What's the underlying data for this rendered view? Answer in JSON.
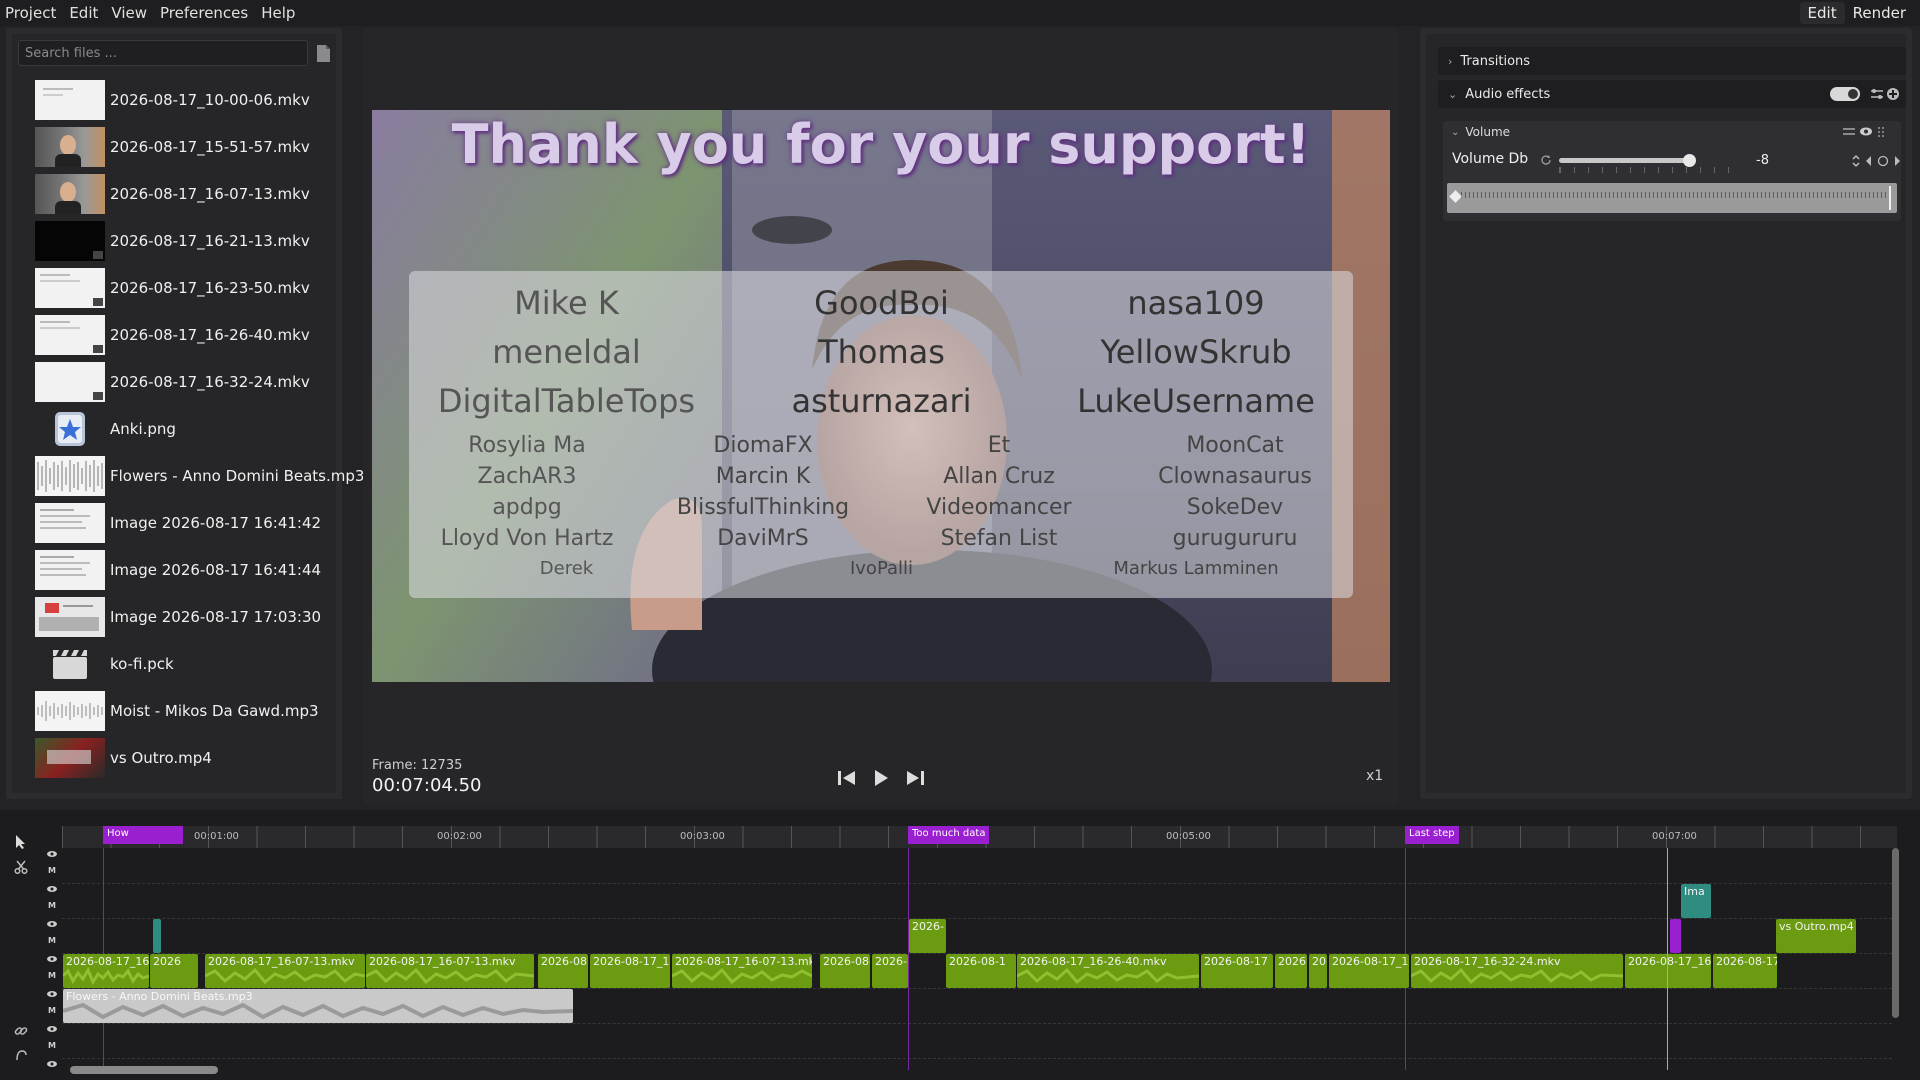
{
  "menu": {
    "items": [
      "Project",
      "Edit",
      "View",
      "Preferences",
      "Help"
    ],
    "right": [
      "Edit",
      "Render"
    ]
  },
  "files": {
    "search_placeholder": "Search files ...",
    "items": [
      {
        "name": "2026-08-17_10-00-06.mkv",
        "thumb": "doc-icon"
      },
      {
        "name": "2026-08-17_15-51-57.mkv",
        "thumb": "person-icon"
      },
      {
        "name": "2026-08-17_16-07-13.mkv",
        "thumb": "person-icon"
      },
      {
        "name": "2026-08-17_16-21-13.mkv",
        "thumb": "black-icon"
      },
      {
        "name": "2026-08-17_16-23-50.mkv",
        "thumb": "doc-icon"
      },
      {
        "name": "2026-08-17_16-26-40.mkv",
        "thumb": "doc-icon"
      },
      {
        "name": "2026-08-17_16-32-24.mkv",
        "thumb": "doc-icon"
      },
      {
        "name": "Anki.png",
        "thumb": "star-icon"
      },
      {
        "name": "Flowers - Anno Domini Beats.mp3",
        "thumb": "waveform-icon"
      },
      {
        "name": "Image 2026-08-17 16:41:42",
        "thumb": "doc-icon"
      },
      {
        "name": "Image 2026-08-17 16:41:44",
        "thumb": "doc-icon"
      },
      {
        "name": "Image 2026-08-17 17:03:30",
        "thumb": "mixed-icon"
      },
      {
        "name": "ko-fi.pck",
        "thumb": "clapper-icon"
      },
      {
        "name": "Moist - Mikos Da Gawd.mp3",
        "thumb": "waveform-icon"
      },
      {
        "name": "vs Outro.mp4",
        "thumb": "outro-icon"
      }
    ]
  },
  "preview": {
    "title": "Thank you for your support!",
    "supporters_big": [
      [
        "Mike K",
        "GoodBoi",
        "nasa109"
      ],
      [
        "meneldal",
        "Thomas",
        "YellowSkrub"
      ],
      [
        "DigitalTableTops",
        "asturnazari",
        "LukeUsername"
      ]
    ],
    "supporters_small": [
      [
        "Rosylia Ma",
        "DiomaFX",
        "Et",
        "MoonCat"
      ],
      [
        "ZachAR3",
        "Marcin K",
        "Allan Cruz",
        "Clownasaurus"
      ],
      [
        "apdpg",
        "BlissfulThinking",
        "Videomancer",
        "SokeDev"
      ],
      [
        "Lloyd Von Hartz",
        "DaviMrS",
        "Stefan List",
        "gurugururu"
      ]
    ],
    "supporters_last": [
      "Derek",
      "IvoPalli",
      "Markus Lamminen"
    ],
    "frame_label": "Frame: 12735",
    "timecode": "00:07:04.50",
    "speed": "x1"
  },
  "effects": {
    "transitions_label": "Transitions",
    "audio_effects_label": "Audio effects",
    "audio_effects_enabled": true,
    "volume_section": "Volume",
    "volume_label": "Volume Db",
    "volume_value": "-8",
    "volume_slider_fraction": 0.78
  },
  "timeline": {
    "ruler_labels": [
      "00:01:00",
      "00:02:00",
      "00:03:00",
      "00:05:00",
      "00:07:00"
    ],
    "markers": [
      "How",
      "Too much data",
      "Last step"
    ],
    "clips_video": [
      "2026-08-17_16",
      "2026",
      "2026-08-17_16-07-13.mkv",
      "2026-08-17_16-07-13.mkv",
      "2026-08",
      "2026-08-17_16",
      "2026-08-17_16-07-13.mk",
      "2026-08-",
      "2026-",
      "2026-08-1",
      "2026-08-17_16-26-40.mkv",
      "2026-08-17",
      "2026",
      "20",
      "2026-08-17_16",
      "2026-08-17_16-32-24.mkv",
      "2026-08-17_16",
      "2026-08-17"
    ],
    "clip_upper": "2026-",
    "clip_image": "Ima",
    "clip_outro": "vs Outro.mp4",
    "clip_audio": "Flowers - Anno Domini Beats.mp3",
    "track_flag": "M"
  }
}
